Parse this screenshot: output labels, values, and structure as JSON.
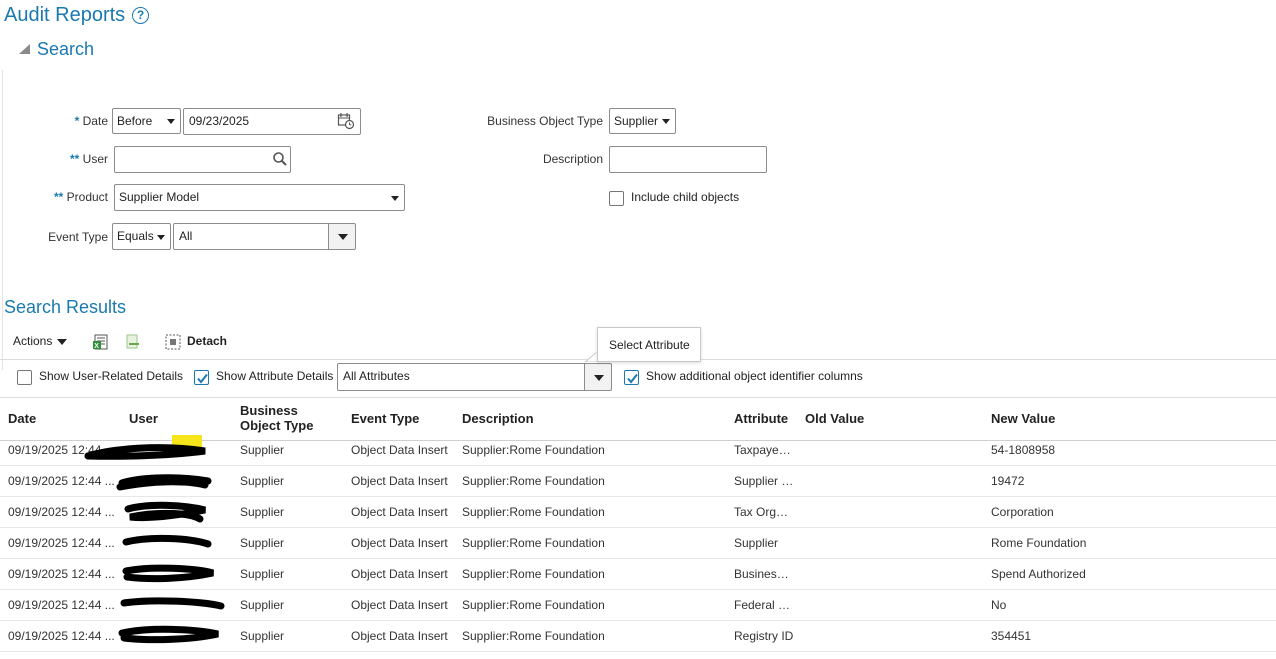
{
  "page": {
    "title": "Audit Reports",
    "search_section_title": "Search",
    "results_title": "Search Results"
  },
  "search": {
    "date_label": "Date",
    "date_required_marker": "*",
    "date_operator": "Before",
    "date_value": "09/23/2025",
    "user_label": "User",
    "user_required_marker": "**",
    "user_value": "",
    "product_label": "Product",
    "product_required_marker": "**",
    "product_value": "Supplier Model",
    "event_type_label": "Event Type",
    "event_type_operator": "Equals",
    "event_type_value": "All",
    "business_object_type_label": "Business Object Type",
    "business_object_type_value": "Supplier",
    "description_label": "Description",
    "description_value": "",
    "include_child_objects_label": "Include child objects",
    "include_child_objects_checked": false
  },
  "toolbar": {
    "actions_label": "Actions",
    "detach_label": "Detach"
  },
  "options": {
    "show_user_related_label": "Show User-Related Details",
    "show_user_related_checked": false,
    "show_attribute_details_label": "Show Attribute Details",
    "show_attribute_details_checked": true,
    "attribute_filter_value": "All Attributes",
    "show_additional_identifiers_label": "Show additional object identifier columns",
    "show_additional_identifiers_checked": true,
    "tooltip": "Select Attribute"
  },
  "table": {
    "columns": {
      "date": "Date",
      "user": "User",
      "business_object_type_line1": "Business",
      "business_object_type_line2": "Object Type",
      "event_type": "Event Type",
      "description": "Description",
      "attribute": "Attribute",
      "old_value": "Old Value",
      "new_value": "New Value"
    },
    "rows": [
      {
        "date": "09/19/2025 12:44",
        "bot": "Supplier",
        "event": "Object Data Insert",
        "desc": "Supplier:Rome Foundation",
        "attr": "Taxpaye…",
        "old": "",
        "new": "54-1808958"
      },
      {
        "date": "09/19/2025 12:44 ...",
        "bot": "Supplier",
        "event": "Object Data Insert",
        "desc": "Supplier:Rome Foundation",
        "attr": "Supplier …",
        "old": "",
        "new": "19472"
      },
      {
        "date": "09/19/2025 12:44 ...",
        "bot": "Supplier",
        "event": "Object Data Insert",
        "desc": "Supplier:Rome Foundation",
        "attr": "Tax Org…",
        "old": "",
        "new": "Corporation"
      },
      {
        "date": "09/19/2025 12:44 ...",
        "bot": "Supplier",
        "event": "Object Data Insert",
        "desc": "Supplier:Rome Foundation",
        "attr": "Supplier",
        "old": "",
        "new": "Rome Foundation"
      },
      {
        "date": "09/19/2025 12:44 ...",
        "bot": "Supplier",
        "event": "Object Data Insert",
        "desc": "Supplier:Rome Foundation",
        "attr": "Busines…",
        "old": "",
        "new": "Spend Authorized"
      },
      {
        "date": "09/19/2025 12:44 ...",
        "bot": "Supplier",
        "event": "Object Data Insert",
        "desc": "Supplier:Rome Foundation",
        "attr": "Federal …",
        "old": "",
        "new": "No"
      },
      {
        "date": "09/19/2025 12:44 ...",
        "bot": "Supplier",
        "event": "Object Data Insert",
        "desc": "Supplier:Rome Foundation",
        "attr": "Registry ID",
        "old": "",
        "new": "354451"
      }
    ]
  },
  "colors": {
    "accent": "#1a7ab0",
    "redaction": "#000000",
    "highlight": "#f5e51a"
  },
  "icons": [
    "help-icon",
    "collapse-icon",
    "calendar-icon",
    "search-icon",
    "chevron-down-icon",
    "export-icon",
    "freeze-icon",
    "detach-icon",
    "checkmark-icon"
  ]
}
